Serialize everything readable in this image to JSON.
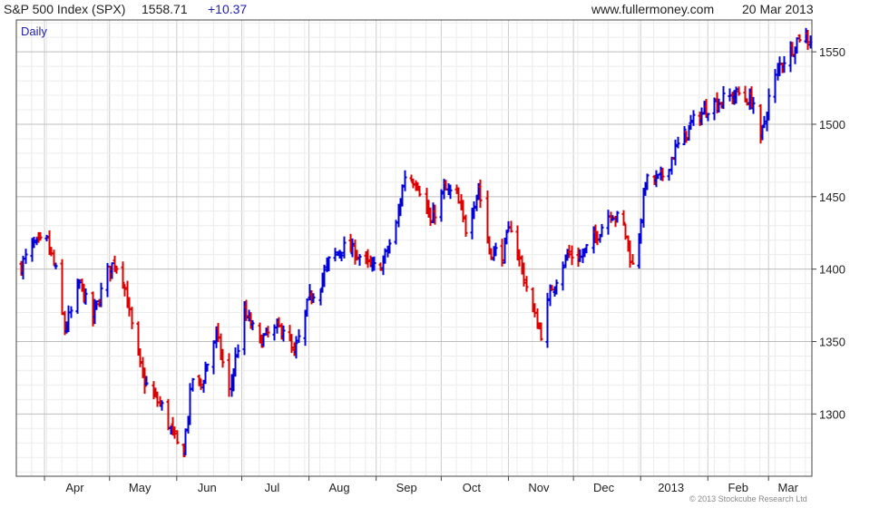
{
  "header": {
    "title": "S&P 500 Index (SPX)",
    "price": "1558.71",
    "change": "+10.37",
    "site": "www.fullermoney.com",
    "date": "20 Mar 2013"
  },
  "chart_label": "Daily",
  "copyright": "© 2013 Stockcube Research Ltd",
  "colors": {
    "up": "#0000dd",
    "down": "#dd0000",
    "grid": "#d9d9d9",
    "axis": "#444444",
    "label": "#1f1fb0"
  },
  "chart_data": {
    "type": "ohlc",
    "xlabel": "",
    "ylabel": "",
    "ylim": [
      1257,
      1572
    ],
    "y_ticks": [
      1300,
      1350,
      1400,
      1450,
      1500,
      1550
    ],
    "y_tick_side": "right",
    "grid": true,
    "x_ticks": [
      "Apr",
      "May",
      "Jun",
      "Jul",
      "Aug",
      "Sep",
      "Oct",
      "Nov",
      "Dec",
      "2013",
      "Feb",
      "Mar"
    ],
    "close_path": [
      [
        "2012-03-21",
        1402
      ],
      [
        "2012-03-26",
        1416
      ],
      [
        "2012-04-02",
        1419
      ],
      [
        "2012-04-06",
        1398
      ],
      [
        "2012-04-10",
        1358
      ],
      [
        "2012-04-13",
        1370
      ],
      [
        "2012-04-17",
        1390
      ],
      [
        "2012-04-23",
        1366
      ],
      [
        "2012-04-30",
        1398
      ],
      [
        "2012-05-03",
        1405
      ],
      [
        "2012-05-07",
        1395
      ],
      [
        "2012-05-11",
        1360
      ],
      [
        "2012-05-16",
        1325
      ],
      [
        "2012-05-21",
        1312
      ],
      [
        "2012-05-25",
        1305
      ],
      [
        "2012-06-01",
        1278
      ],
      [
        "2012-06-04",
        1275
      ],
      [
        "2012-06-08",
        1325
      ],
      [
        "2012-06-12",
        1320
      ],
      [
        "2012-06-19",
        1355
      ],
      [
        "2012-06-25",
        1315
      ],
      [
        "2012-07-02",
        1370
      ],
      [
        "2012-07-09",
        1350
      ],
      [
        "2012-07-13",
        1355
      ],
      [
        "2012-07-20",
        1360
      ],
      [
        "2012-07-25",
        1340
      ],
      [
        "2012-08-01",
        1380
      ],
      [
        "2012-08-06",
        1390
      ],
      [
        "2012-08-10",
        1405
      ],
      [
        "2012-08-16",
        1415
      ],
      [
        "2012-08-22",
        1412
      ],
      [
        "2012-08-30",
        1400
      ],
      [
        "2012-09-04",
        1405
      ],
      [
        "2012-09-10",
        1430
      ],
      [
        "2012-09-14",
        1465
      ],
      [
        "2012-09-20",
        1460
      ],
      [
        "2012-09-26",
        1432
      ],
      [
        "2012-10-02",
        1455
      ],
      [
        "2012-10-08",
        1450
      ],
      [
        "2012-10-12",
        1428
      ],
      [
        "2012-10-18",
        1457
      ],
      [
        "2012-10-23",
        1413
      ],
      [
        "2012-10-29",
        1411
      ],
      [
        "2012-11-02",
        1430
      ],
      [
        "2012-11-07",
        1400
      ],
      [
        "2012-11-12",
        1370
      ],
      [
        "2012-11-16",
        1356
      ],
      [
        "2012-11-21",
        1388
      ],
      [
        "2012-11-28",
        1410
      ],
      [
        "2012-12-04",
        1408
      ],
      [
        "2012-12-10",
        1420
      ],
      [
        "2012-12-18",
        1440
      ],
      [
        "2012-12-24",
        1430
      ],
      [
        "2012-12-28",
        1402
      ],
      [
        "2012-12-31",
        1425
      ],
      [
        "2013-01-03",
        1460
      ],
      [
        "2013-01-10",
        1462
      ],
      [
        "2013-01-18",
        1485
      ],
      [
        "2013-01-25",
        1502
      ],
      [
        "2013-02-01",
        1512
      ],
      [
        "2013-02-08",
        1517
      ],
      [
        "2013-02-15",
        1521
      ],
      [
        "2013-02-22",
        1515
      ],
      [
        "2013-02-25",
        1487
      ],
      [
        "2013-03-01",
        1518
      ],
      [
        "2013-03-06",
        1541
      ],
      [
        "2013-03-12",
        1553
      ],
      [
        "2013-03-15",
        1561
      ],
      [
        "2013-03-20",
        1559
      ]
    ]
  }
}
